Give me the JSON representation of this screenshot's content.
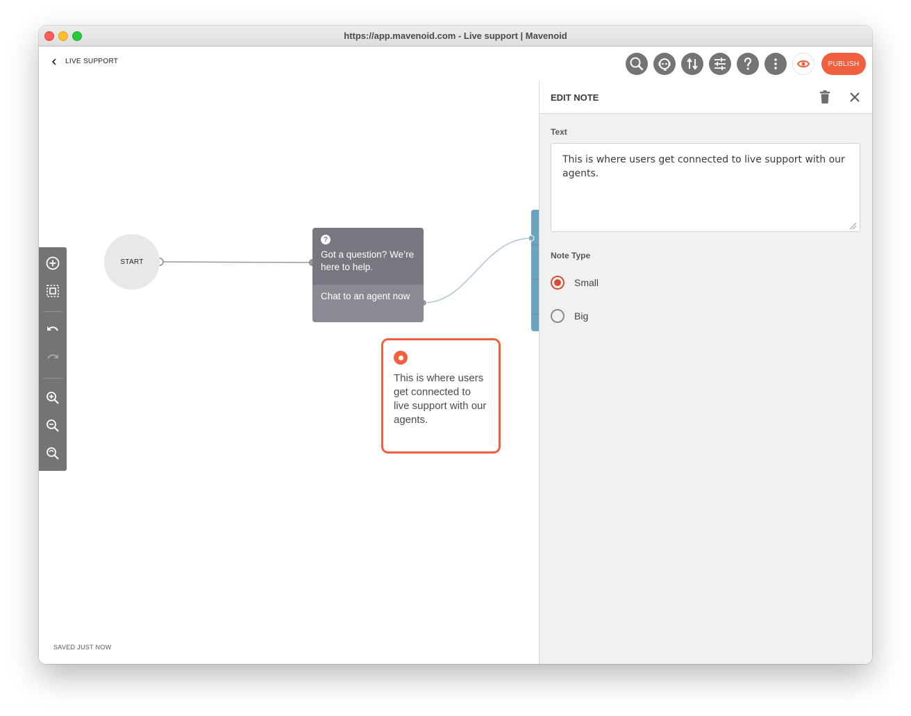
{
  "window": {
    "title": "https://app.mavenoid.com - Live support | Mavenoid"
  },
  "header": {
    "back_label": "LIVE SUPPORT",
    "publish_label": "PUBLISH"
  },
  "toolbar": {
    "icons": [
      "search-icon",
      "chatbot-icon",
      "import-export-icon",
      "settings-sliders-icon",
      "help-icon",
      "more-icon",
      "preview-eye-icon"
    ]
  },
  "canvas": {
    "start_label": "START",
    "question_node": {
      "icon": "?",
      "text": "Got a question? We’re here to help.",
      "answer": "Chat to an agent now"
    },
    "note": {
      "text": "This is where users get connected to live support with our agents."
    }
  },
  "footer": {
    "saved_status": "SAVED JUST NOW"
  },
  "edit_panel": {
    "title": "EDIT NOTE",
    "text_label": "Text",
    "text_value": "This is where users get connected to live support with our agents.",
    "note_type_label": "Note Type",
    "options": [
      {
        "label": "Small",
        "checked": true
      },
      {
        "label": "Big",
        "checked": false
      }
    ]
  },
  "colors": {
    "accent": "#f0603e",
    "node_gray": "#76777f",
    "teal": "#6aa5bd",
    "panel_bg": "#f1f1f1"
  }
}
